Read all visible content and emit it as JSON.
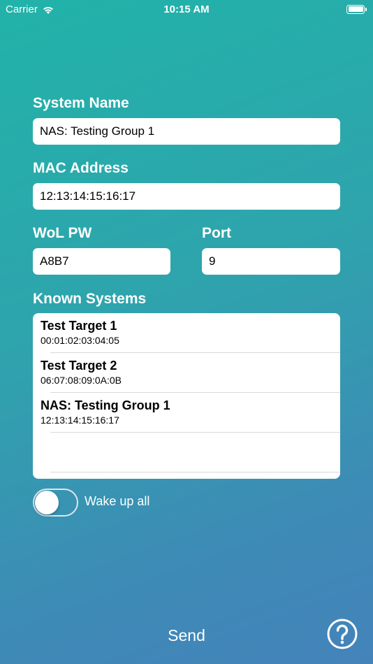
{
  "status_bar": {
    "carrier": "Carrier",
    "time": "10:15 AM",
    "wifi_icon": "wifi-icon",
    "battery_icon": "battery-icon"
  },
  "form": {
    "system_name": {
      "label": "System Name",
      "value": "NAS: Testing Group 1"
    },
    "mac_address": {
      "label": "MAC Address",
      "value": "12:13:14:15:16:17"
    },
    "wol_pw": {
      "label": "WoL PW",
      "value": "A8B7"
    },
    "port": {
      "label": "Port",
      "value": "9"
    }
  },
  "known_systems": {
    "label": "Known Systems",
    "items": [
      {
        "name": "Test Target 1",
        "mac": "00:01:02:03:04:05"
      },
      {
        "name": "Test Target 2",
        "mac": "06:07:08:09:0A:0B"
      },
      {
        "name": "NAS: Testing Group 1",
        "mac": "12:13:14:15:16:17"
      }
    ]
  },
  "wake_all": {
    "label": "Wake up all",
    "on": false
  },
  "footer": {
    "send_label": "Send",
    "help_icon": "help-icon"
  },
  "colors": {
    "gradient_start": "#21b3a9",
    "gradient_end": "#4483ba"
  }
}
